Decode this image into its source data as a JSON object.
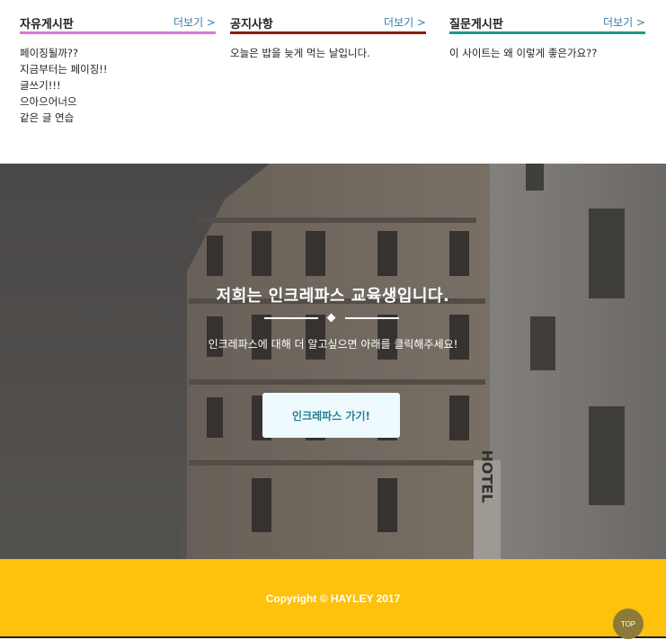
{
  "boards": [
    {
      "title": "자유게시판",
      "more_label": "더보기 >",
      "accent": "#d97ad5",
      "posts": [
        "페이징될까??",
        "지금부터는 페이징!!",
        "글쓰기!!!",
        "으아으어너으",
        "같은 글 연습"
      ]
    },
    {
      "title": "공지사항",
      "more_label": "더보기 >",
      "accent": "#8b1a12",
      "posts": [
        "오늘은 밥을 늦게 먹는 날입니다."
      ]
    },
    {
      "title": "질문게시판",
      "more_label": "더보기 >",
      "accent": "#1d9a86",
      "posts": [
        "이 사이트는 왜 이렇게 좋은가요??"
      ]
    }
  ],
  "hero": {
    "title": "저희는 인크레파스 교육생입니다.",
    "subtitle": "인크레파스에 대해 더 알고싶으면 아래를 클릭해주세요!",
    "button_label": "인크레파스 가기!",
    "sign_text": "HOTEL"
  },
  "footer": {
    "copyright": "Copyright © HAYLEY 2017",
    "top_label": "TOP",
    "background": "#fdc10e"
  }
}
